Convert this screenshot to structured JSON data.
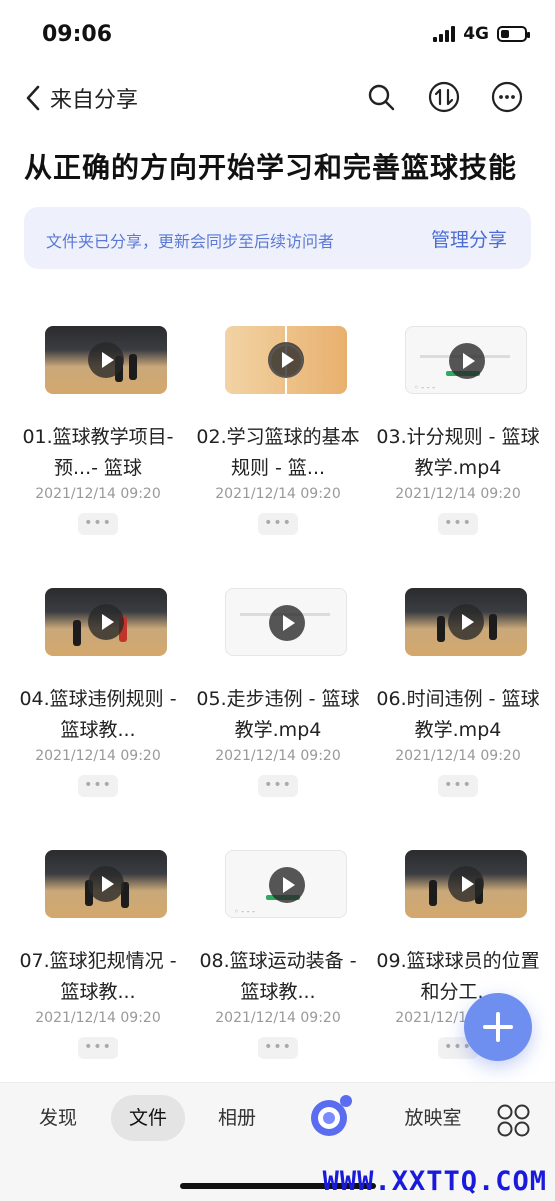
{
  "status_bar": {
    "time": "09:06",
    "network": "4G"
  },
  "nav": {
    "back_label": "来自分享",
    "icons": [
      "search-icon",
      "transfer-icon",
      "more-icon"
    ]
  },
  "page_title": "从正确的方向开始学习和完善篮球技能",
  "share_banner": {
    "text": "文件夹已分享，更新会同步至后续访问者",
    "action": "管理分享"
  },
  "files": [
    {
      "name": "01.篮球教学项目-预...- 篮球",
      "date": "2021/12/14 09:20",
      "more": "•••",
      "thumb": "gym"
    },
    {
      "name": "02.学习篮球的基本规则 - 篮...",
      "date": "2021/12/14 09:20",
      "more": "•••",
      "thumb": "court"
    },
    {
      "name": "03.计分规则 - 篮球教学.mp4",
      "date": "2021/12/14 09:20",
      "more": "•••",
      "thumb": "doc"
    },
    {
      "name": "04.篮球违例规则 - 篮球教...",
      "date": "2021/12/14 09:20",
      "more": "•••",
      "thumb": "gym"
    },
    {
      "name": "05.走步违例 - 篮球教学.mp4",
      "date": "2021/12/14 09:20",
      "more": "•••",
      "thumb": "doc"
    },
    {
      "name": "06.时间违例 - 篮球教学.mp4",
      "date": "2021/12/14 09:20",
      "more": "•••",
      "thumb": "gym"
    },
    {
      "name": "07.篮球犯规情况 - 篮球教...",
      "date": "2021/12/14 09:20",
      "more": "•••",
      "thumb": "gym"
    },
    {
      "name": "08.篮球运动装备 - 篮球教...",
      "date": "2021/12/14 09:20",
      "more": "•••",
      "thumb": "doc"
    },
    {
      "name": "09.篮球球员的位置和分工...",
      "date": "2021/12/14 09:20",
      "more": "•••",
      "thumb": "gym"
    }
  ],
  "tabbar": {
    "tabs": [
      {
        "label": "发现",
        "active": false
      },
      {
        "label": "文件",
        "active": true
      },
      {
        "label": "相册",
        "active": false
      },
      {
        "label": "放映室",
        "active": false
      }
    ]
  },
  "watermark": "WWW.XXTTQ.COM",
  "colors": {
    "accent": "#4a6cd4",
    "banner_bg": "#eef1fb",
    "fab": "#6f8ff0"
  }
}
